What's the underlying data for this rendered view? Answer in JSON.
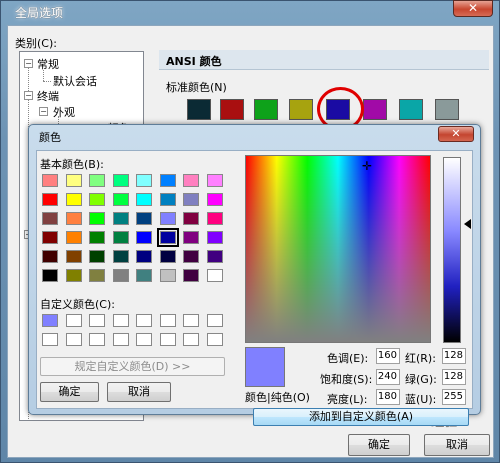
{
  "outer": {
    "title": "全局选项",
    "close_glyph": "✕",
    "category_label": "类别(C):",
    "tree": {
      "items": [
        {
          "label": "常规",
          "expanded": true
        },
        {
          "label": "默认会话"
        },
        {
          "label": "终端",
          "expanded": true
        },
        {
          "label": "外观",
          "expanded": true
        },
        {
          "label": "ANSI 颜色"
        }
      ],
      "collapsed_glyph": "+",
      "expanded_glyph": "−"
    },
    "ansi": {
      "header": "ANSI 颜色",
      "standard_label": "标准颜色(N)",
      "standard_colors": [
        "#0b2a34",
        "#a90f10",
        "#0ea21a",
        "#a7a30f",
        "#1a0ba3",
        "#a10aa7",
        "#0aa6a7",
        "#8a9a9a"
      ]
    },
    "buttons": {
      "ok": "确定",
      "cancel": "取消"
    },
    "watermark": "Baidu 经验"
  },
  "dialog": {
    "title": "颜色",
    "close_glyph": "✕",
    "basic_label": "基本颜色(B):",
    "basic_colors": [
      [
        "#ff8080",
        "#ffff80",
        "#80ff80",
        "#00ff80",
        "#80ffff",
        "#0080ff",
        "#ff80c0",
        "#ff80ff"
      ],
      [
        "#ff0000",
        "#ffff00",
        "#80ff00",
        "#00ff40",
        "#00ffff",
        "#0080c0",
        "#8080c0",
        "#ff00ff"
      ],
      [
        "#804040",
        "#ff8040",
        "#00ff00",
        "#008080",
        "#004080",
        "#8080ff",
        "#800040",
        "#ff0080"
      ],
      [
        "#800000",
        "#ff8000",
        "#008000",
        "#008040",
        "#0000ff",
        "#0000a0",
        "#800080",
        "#8000ff"
      ],
      [
        "#400000",
        "#804000",
        "#004000",
        "#004040",
        "#000080",
        "#000040",
        "#400040",
        "#400080"
      ],
      [
        "#000000",
        "#808000",
        "#808040",
        "#808080",
        "#408080",
        "#c0c0c0",
        "#400040",
        "#ffffff"
      ]
    ],
    "custom_label": "自定义颜色(C):",
    "custom_colors": [
      "#8080ff",
      "#ffffff",
      "#ffffff",
      "#ffffff",
      "#ffffff",
      "#ffffff",
      "#ffffff",
      "#ffffff",
      "#ffffff",
      "#ffffff",
      "#ffffff",
      "#ffffff",
      "#ffffff",
      "#ffffff",
      "#ffffff",
      "#ffffff"
    ],
    "define_button": "规定自定义颜色(D) >>",
    "ok_button": "确定",
    "cancel_button": "取消",
    "preview_label": "颜色|纯色(O)",
    "preview_color": "#8080ff",
    "add_button": "添加到自定义颜色(A)",
    "fields": {
      "hue_label": "色调(E):",
      "hue": "160",
      "sat_label": "饱和度(S):",
      "sat": "240",
      "lum_label": "亮度(L):",
      "lum": "180",
      "red_label": "红(R):",
      "red": "128",
      "green_label": "绿(G):",
      "green": "128",
      "blue_label": "蓝(U):",
      "blue": "255"
    }
  }
}
